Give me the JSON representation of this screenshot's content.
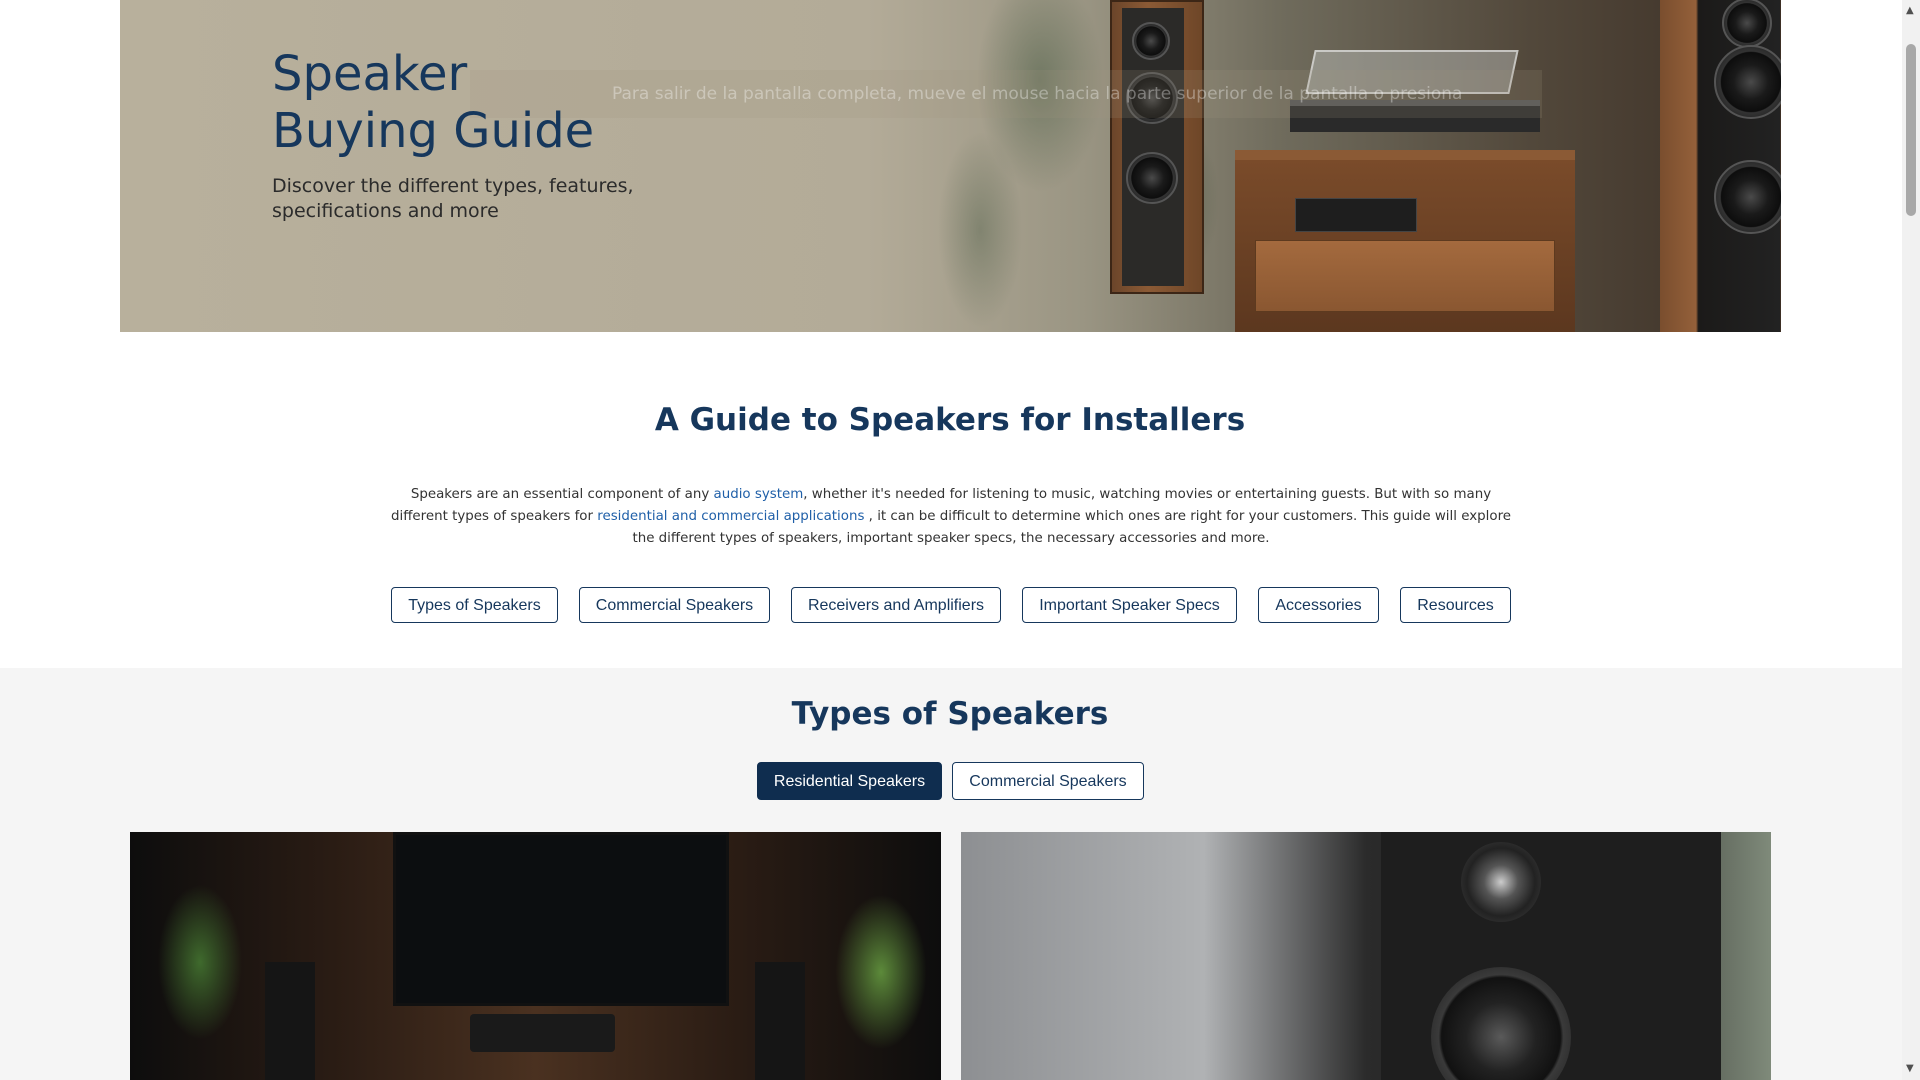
{
  "hero": {
    "title": "Speaker\nBuying Guide",
    "subtitle": "Discover the different types, features, specifications and more",
    "fullscreen_notice": "Para salir de la pantalla completa, mueve el mouse hacia la parte superior de la pantalla o presiona"
  },
  "intro": {
    "title": "A Guide to Speakers for Installers",
    "text_part1": "Speakers are an essential component of any ",
    "link1": "audio system",
    "text_part2": ", whether it's needed for listening to music, watching movies or entertaining guests. But with so many different types of speakers for ",
    "link2": "residential and commercial applications",
    "text_part3": " , it can be difficult to determine which ones are right for your customers. This guide will explore the different types of speakers, important speaker specs, the necessary accessories and more."
  },
  "nav_buttons": [
    {
      "label": "Types of Speakers"
    },
    {
      "label": "Commercial Speakers"
    },
    {
      "label": "Receivers and Amplifiers"
    },
    {
      "label": "Important Speaker Specs"
    },
    {
      "label": "Accessories"
    },
    {
      "label": "Resources"
    }
  ],
  "types": {
    "title": "Types of Speakers",
    "tabs": [
      {
        "label": "Residential Speakers",
        "active": true
      },
      {
        "label": "Commercial Speakers",
        "active": false
      }
    ]
  },
  "colors": {
    "brand_navy": "#16375c",
    "link_blue": "#1f5fa8",
    "active_tab": "#0f2d4f"
  }
}
